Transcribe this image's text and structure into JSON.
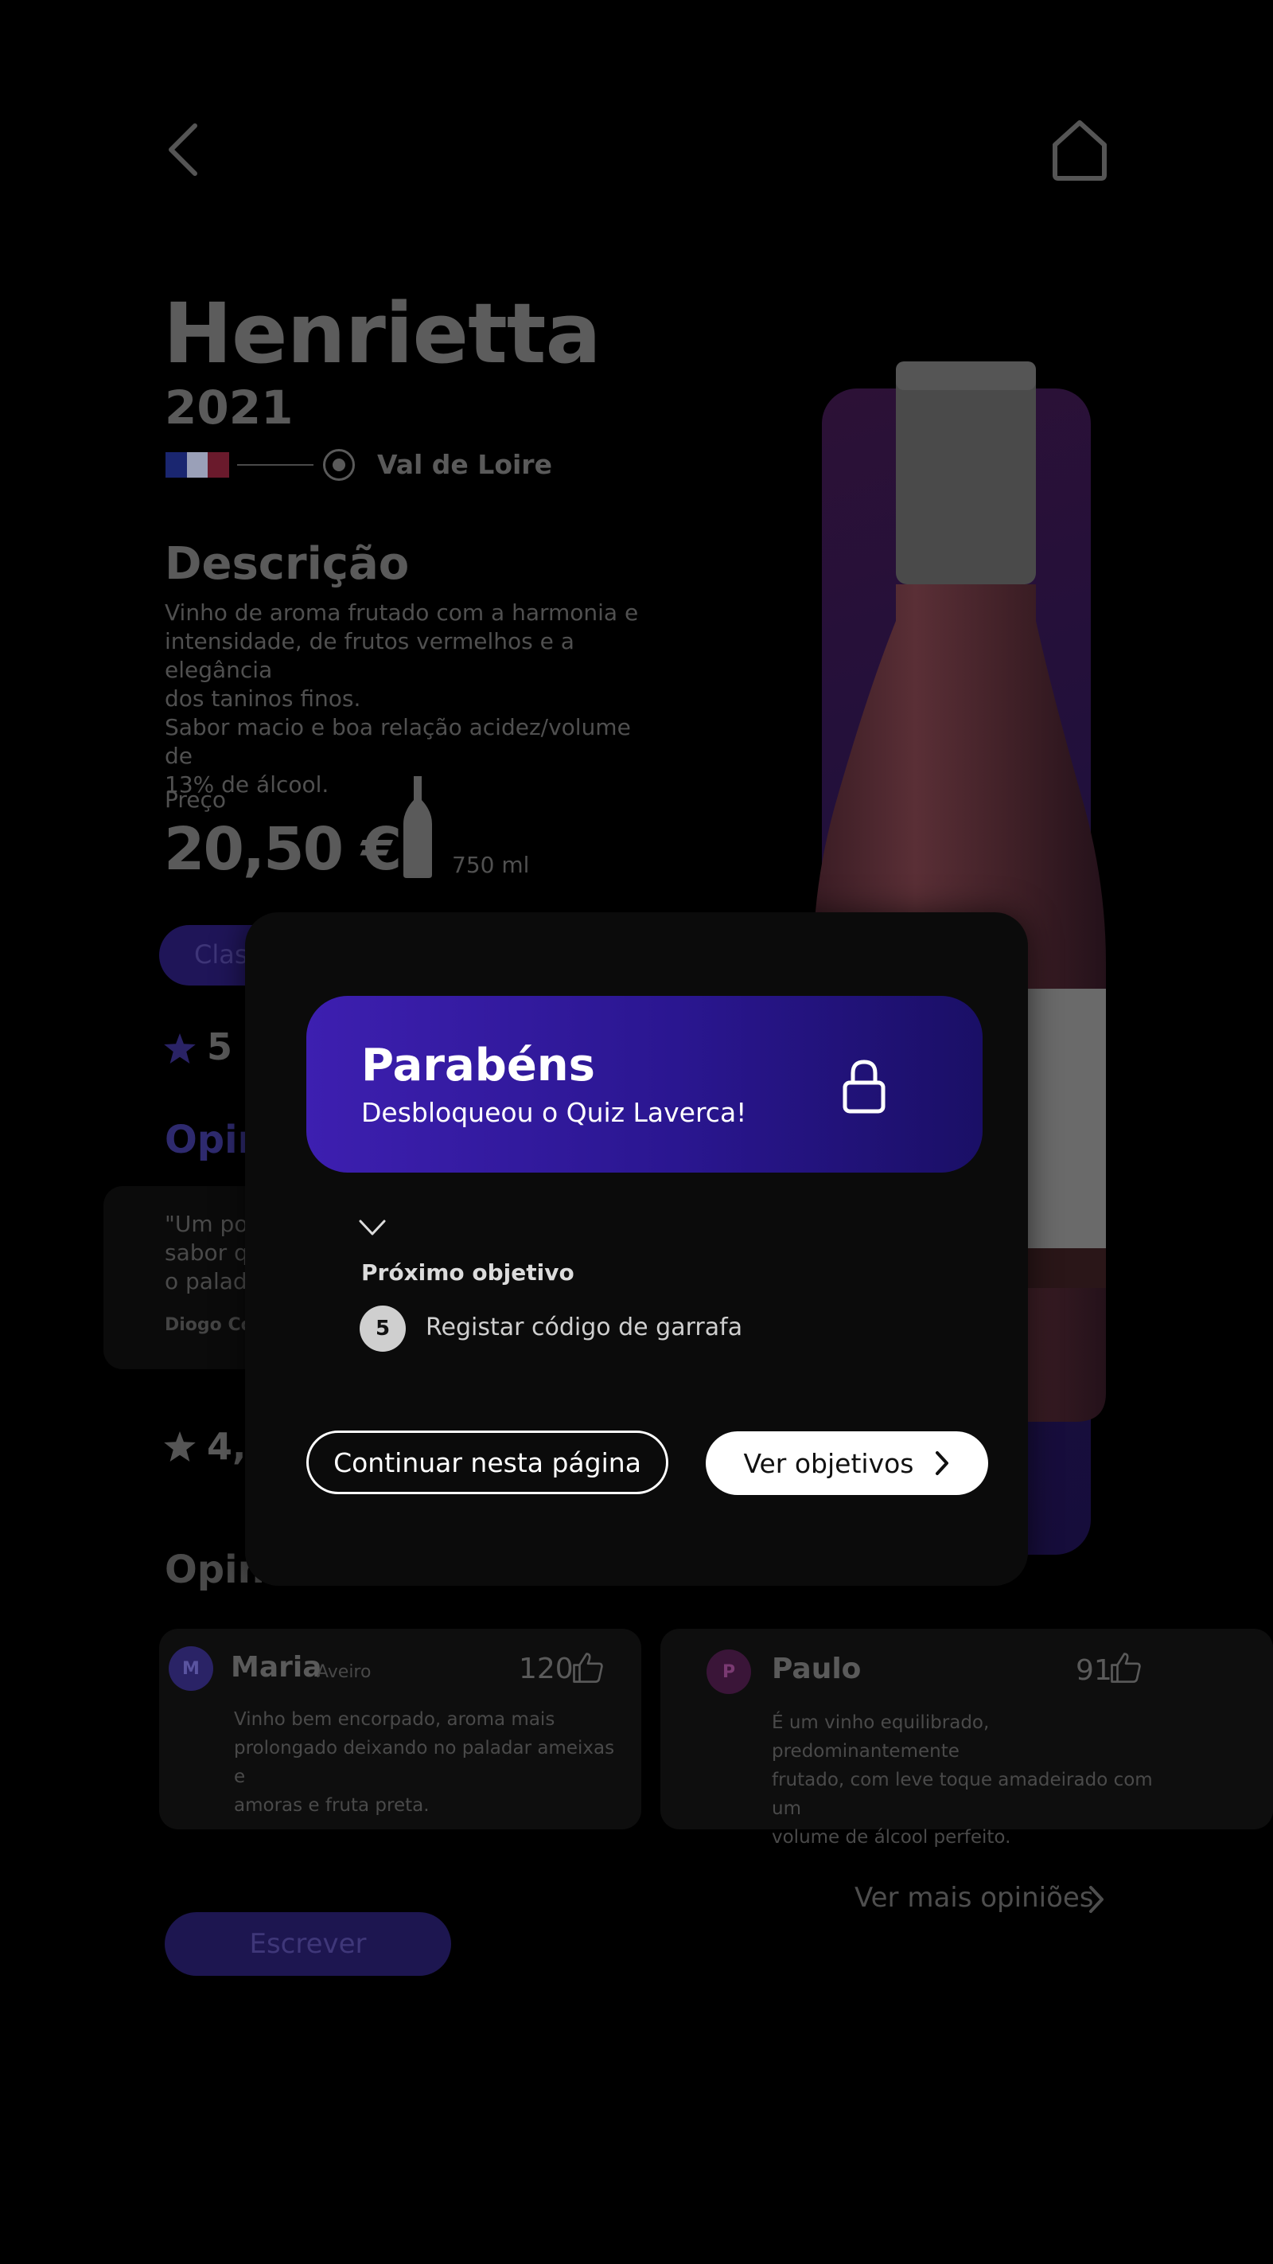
{
  "nav": {
    "back_icon": "chevron-left-icon",
    "home_icon": "home-icon"
  },
  "wine": {
    "name": "Henrietta",
    "year": "2021",
    "region": "Val de Loire",
    "flag_colors": [
      "#1a2670",
      "#9aa0b8",
      "#6a1a2c"
    ]
  },
  "description": {
    "heading": "Descrição",
    "text_lines": [
      "Vinho de aroma frutado com a harmonia e",
      "intensidade, de frutos vermelhos e a elegância",
      "dos taninos finos.",
      "Sabor macio e boa relação acidez/volume de",
      "13% de álcool."
    ]
  },
  "price": {
    "label": "Preço",
    "value": "20,50 €",
    "volume": "750 ml"
  },
  "classify_button": {
    "label": "Clas"
  },
  "rating_top": {
    "value": "5"
  },
  "opinions_top": {
    "heading": "Opin"
  },
  "quote": {
    "lines": [
      "\"Um por",
      "sabor q",
      "o palad"
    ],
    "author": "Diogo Cos"
  },
  "rating_bottom": {
    "value": "4,5"
  },
  "opinions_bottom": {
    "heading": "Opini"
  },
  "reviews": [
    {
      "initial": "M",
      "name": "Maria",
      "location": "Aveiro",
      "likes": "120",
      "lines": [
        "Vinho bem encorpado, aroma mais",
        "prolongado deixando no paladar ameixas e",
        "amoras e fruta preta."
      ],
      "avatar_color": "#2a2366"
    },
    {
      "initial": "P",
      "name": "Paulo",
      "location": "",
      "likes": "91",
      "lines": [
        "É um vinho equilibrado, predominantemente",
        "frutado, com leve toque amadeirado com um",
        "volume de álcool perfeito."
      ],
      "avatar_color": "#4a1a4a"
    }
  ],
  "more_opinions": {
    "label": "Ver mais opiniões"
  },
  "write_button": {
    "label": "Escrever"
  },
  "modal": {
    "title": "Parabéns",
    "subtitle": "Desbloqueou o Quiz Laverca!",
    "next_heading": "Próximo objetivo",
    "next_number": "5",
    "next_text": "Registar código de garrafa",
    "continue_label": "Continuar nesta página",
    "objectives_label": "Ver objetivos",
    "accent": "#3d1fb0"
  }
}
